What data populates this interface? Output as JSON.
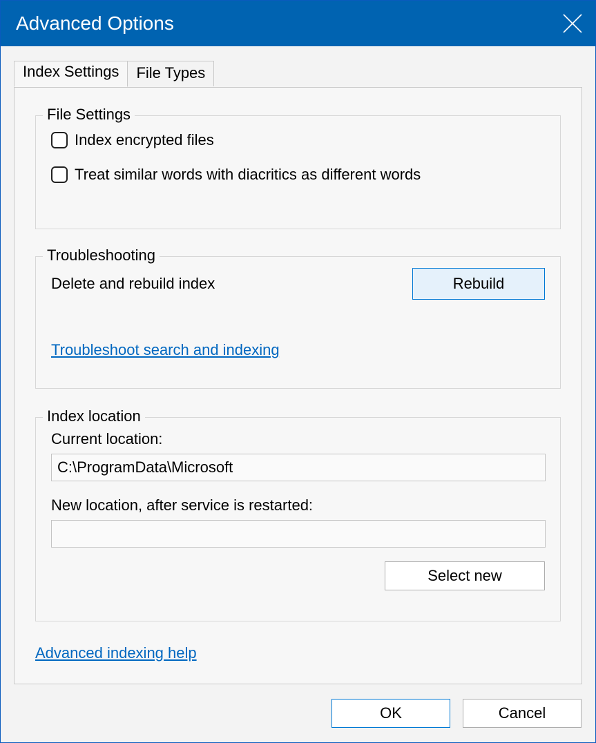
{
  "window": {
    "title": "Advanced Options"
  },
  "tabs": {
    "index_settings": "Index Settings",
    "file_types": "File Types"
  },
  "file_settings": {
    "legend": "File Settings",
    "encrypted": "Index encrypted files",
    "diacritics": "Treat similar words with diacritics as different words"
  },
  "troubleshooting": {
    "legend": "Troubleshooting",
    "delete_label": "Delete and rebuild index",
    "rebuild_btn": "Rebuild",
    "link": "Troubleshoot search and indexing"
  },
  "index_location": {
    "legend": "Index location",
    "current_label": "Current location:",
    "current_value": "C:\\ProgramData\\Microsoft",
    "new_label": "New location, after service is restarted:",
    "new_value": "",
    "select_btn": "Select new"
  },
  "help_link": "Advanced indexing help",
  "buttons": {
    "ok": "OK",
    "cancel": "Cancel"
  }
}
